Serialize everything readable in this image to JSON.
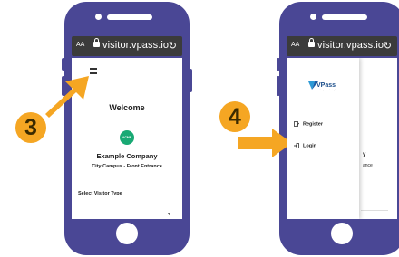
{
  "left_phone": {
    "browser": {
      "text_size_label": "AA",
      "url": "visitor.vpass.io",
      "reload_icon": "reload-icon"
    },
    "page": {
      "menu_icon": "hamburger-icon",
      "welcome": "Welcome",
      "logo_text": "ACME",
      "company": "Example Company",
      "location": "City Campus - Front Entrance",
      "visitor_type_label": "Select Visitor Type"
    }
  },
  "right_phone": {
    "browser": {
      "text_size_label": "AA",
      "url": "visitor.vpass.io",
      "reload_icon": "reload-icon"
    },
    "drawer": {
      "logo_text": "VPass",
      "logo_tagline": "visitor pass made simple",
      "items": [
        {
          "label": "Register",
          "icon": "register-icon"
        },
        {
          "label": "Login",
          "icon": "login-icon"
        }
      ]
    },
    "behind_page": {
      "company_partial": "y",
      "location_partial": "ance"
    }
  },
  "steps": [
    "3",
    "4"
  ],
  "colors": {
    "phone": "#4a4795",
    "step_badge": "#f5a623",
    "arrow": "#f5a623",
    "acme_logo": "#19a974",
    "url_bar": "#3b3b3b"
  }
}
